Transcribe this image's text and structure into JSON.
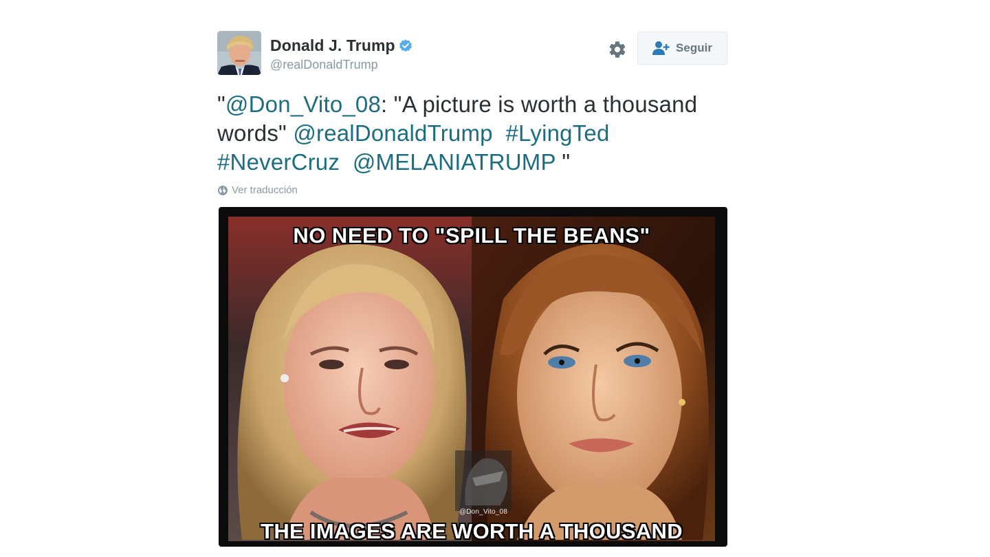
{
  "user": {
    "full_name": "Donald J. Trump",
    "handle": "@realDonaldTrump",
    "verified": true,
    "avatar_icon": "profile-photo"
  },
  "actions": {
    "settings_icon": "gear-icon",
    "follow_label": "Seguir",
    "follow_icon": "add-user-icon"
  },
  "tweet": {
    "parts": [
      {
        "text": "\"",
        "link": false
      },
      {
        "text": "@Don_Vito_08",
        "link": true
      },
      {
        "text": ": \"A picture is worth a thousand words\" ",
        "link": false
      },
      {
        "text": "@realDonaldTrump",
        "link": true
      },
      {
        "text": "  ",
        "link": false
      },
      {
        "text": "#LyingTed",
        "link": true
      },
      {
        "text": " ",
        "link": false
      },
      {
        "text": "#NeverCruz",
        "link": true
      },
      {
        "text": "  ",
        "link": false
      },
      {
        "text": "@MELANIATRUMP",
        "link": true
      },
      {
        "text": " \"",
        "link": false
      }
    ],
    "translate_label": "Ver traducción",
    "translate_icon": "globe-icon"
  },
  "media": {
    "top_caption": "NO NEED TO \"SPILL THE BEANS\"",
    "bottom_caption": "THE IMAGES ARE WORTH A THOUSAND WORDS",
    "watermark": "@Don_Vito_08"
  },
  "colors": {
    "link": "#1c6d82",
    "verified": "#55acee",
    "muted": "#8899a6",
    "text": "#292f33"
  }
}
